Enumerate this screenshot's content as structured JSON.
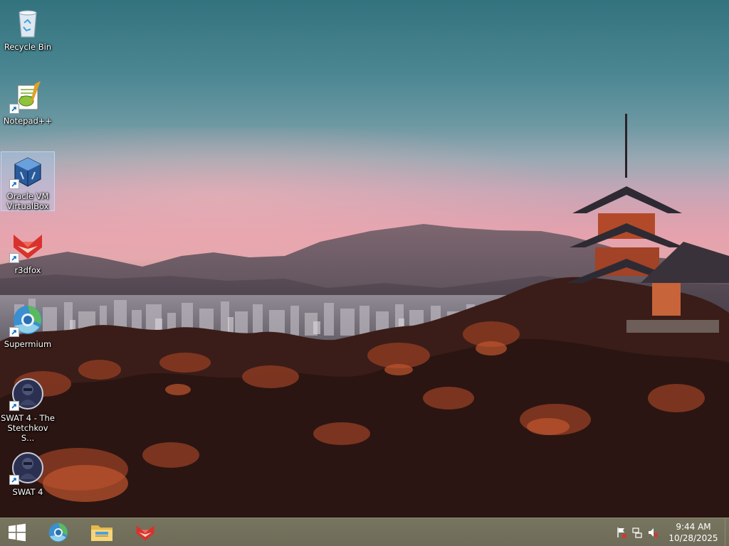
{
  "desktop": {
    "icons": [
      {
        "label": "Recycle Bin",
        "icon": "recycle-bin-icon",
        "shortcut": false,
        "selected": false
      },
      {
        "label": "Notepad++",
        "icon": "notepad-plus-plus-icon",
        "shortcut": true,
        "selected": false
      },
      {
        "label": "Oracle VM VirtualBox",
        "icon": "virtualbox-icon",
        "shortcut": true,
        "selected": true
      },
      {
        "label": "r3dfox",
        "icon": "r3dfox-icon",
        "shortcut": true,
        "selected": false
      },
      {
        "label": "Supermium",
        "icon": "supermium-icon",
        "shortcut": true,
        "selected": false
      },
      {
        "label": "SWAT 4 - The Stetchkov S...",
        "icon": "swat4-icon",
        "shortcut": true,
        "selected": false
      },
      {
        "label": "SWAT 4",
        "icon": "swat4-icon",
        "shortcut": true,
        "selected": false
      }
    ]
  },
  "taskbar": {
    "start_icon": "windows-logo-icon",
    "pinned": [
      {
        "icon": "supermium-icon"
      },
      {
        "icon": "file-explorer-icon"
      },
      {
        "icon": "r3dfox-icon"
      }
    ],
    "tray": [
      {
        "icon": "action-center-flag-icon"
      },
      {
        "icon": "network-icon"
      },
      {
        "icon": "volume-muted-icon"
      }
    ],
    "clock": {
      "time": "9:44 AM",
      "date": "10/28/2025"
    }
  },
  "colors": {
    "taskbar": "#6e6c58",
    "selection": "#aacdf5",
    "sky_top": "#33737e",
    "sky_glow": "#e6a2ad"
  }
}
